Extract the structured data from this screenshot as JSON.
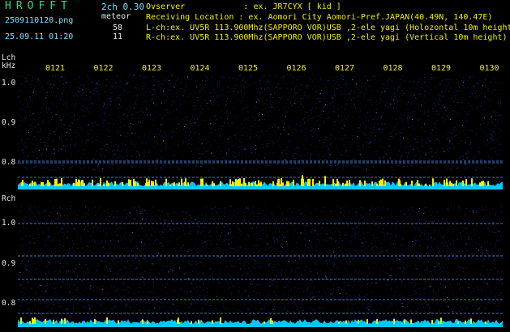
{
  "header": {
    "title": "HROFFT",
    "version": "2ch 0.30",
    "filename": "2509110120.png",
    "meteor_label": "meteor",
    "meteor_counts": {
      "lch": "58",
      "rch": "11"
    },
    "timestamp": "25.09.11 01:20",
    "observer": "Ovserver            : ex. JR7CYX [ kid ]",
    "location": "Receiving Location : ex. Aomori City Aomori-Pref.JAPAN(40.49N, 140.47E)",
    "lch_info": "L-ch:ex. UV5R 113.900Mhz(SAPPORO VOR)USB ,2-ele yagi (Holozontal 10m height)",
    "rch_info": "R-ch:ex. UV5R 113.900Mhz(SAPPORO VOR)USB ,2-ele yagi (Vertical 10m height)"
  },
  "lch": {
    "label": "Lch",
    "unit": "kHz",
    "y_ticks": [
      "1.0",
      "0.9",
      "0.8"
    ],
    "time_ticks": [
      "0121",
      "0122",
      "0123",
      "0124",
      "0125",
      "0126",
      "0127",
      "0128",
      "0129",
      "0130"
    ]
  },
  "rch": {
    "label": "Rch",
    "y_ticks": [
      "1.0",
      "0.9",
      "0.8"
    ]
  },
  "colors": {
    "background": "#000000",
    "noise": "#1a2a7a",
    "signal_line": "#3a7ad0",
    "meteor_bar": "#f4f000",
    "trace": "#00c8ff"
  }
}
